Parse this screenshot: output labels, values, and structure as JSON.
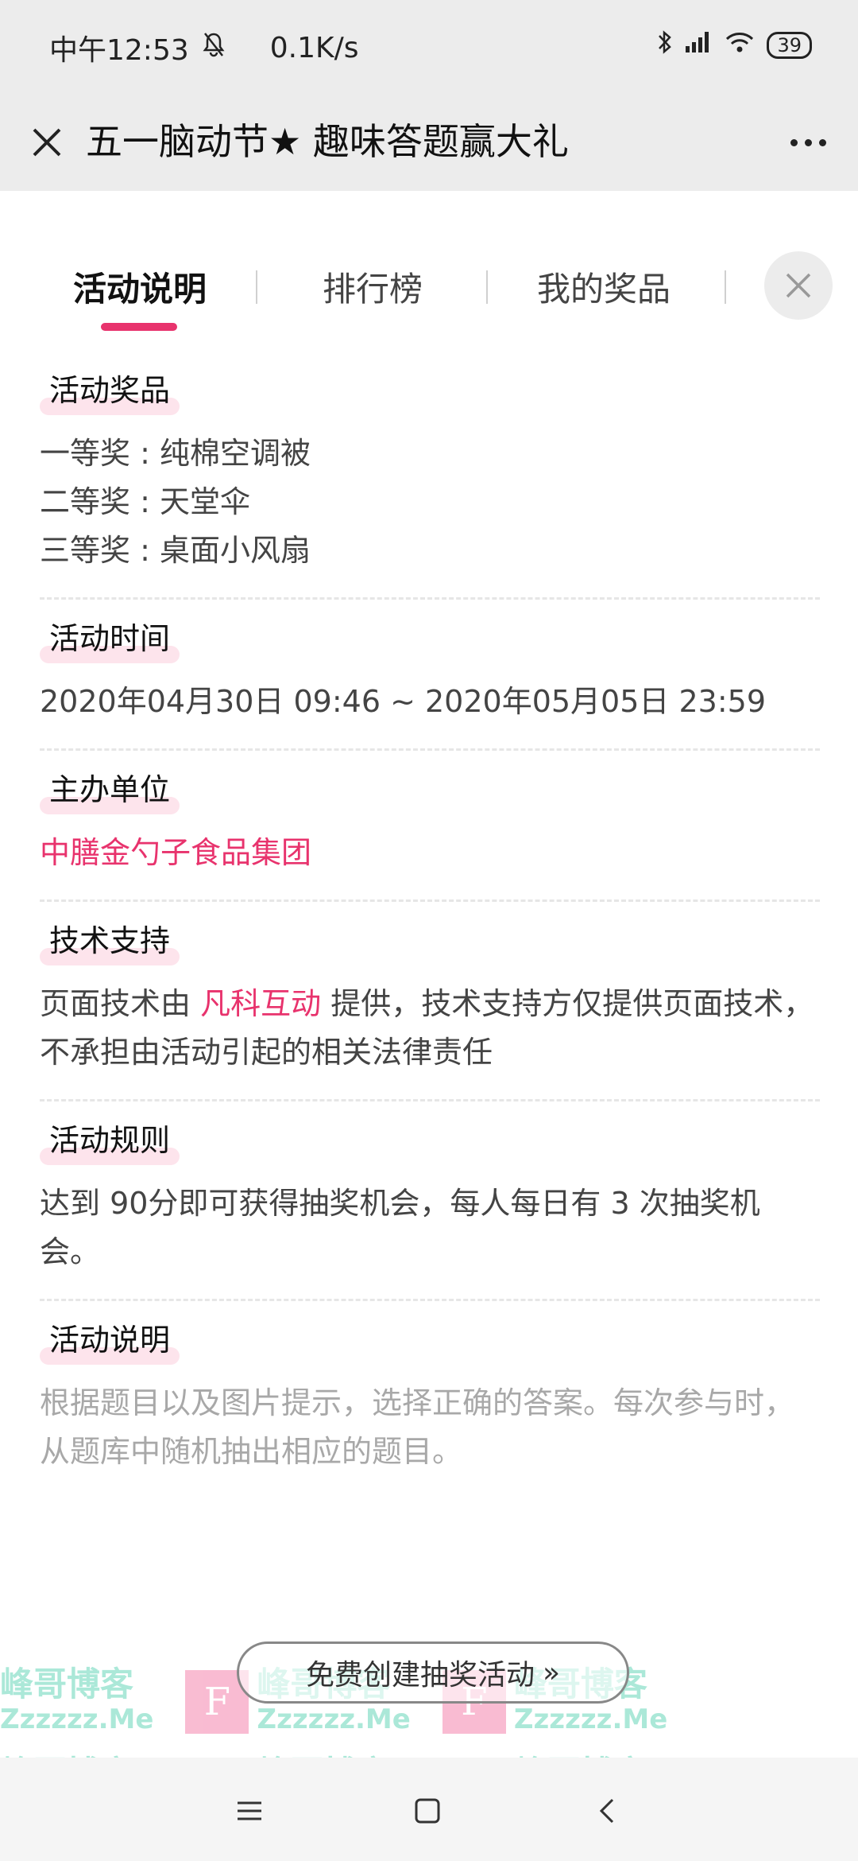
{
  "status": {
    "time": "中午12:53",
    "speed": "0.1K/s",
    "battery": "39"
  },
  "nav": {
    "title": "五一脑动节★ 趣味答题赢大礼"
  },
  "tabs": [
    {
      "label": "活动说明"
    },
    {
      "label": "排行榜"
    },
    {
      "label": "我的奖品"
    }
  ],
  "sections": {
    "prizes": {
      "title": "活动奖品",
      "lines": [
        "一等奖 : 纯棉空调被",
        "二等奖 : 天堂伞",
        "三等奖 : 桌面小风扇"
      ]
    },
    "time": {
      "title": "活动时间",
      "text": "2020年04月30日 09:46 ~ 2020年05月05日 23:59"
    },
    "organizer": {
      "title": "主办单位",
      "text": "中膳金勺子食品集团"
    },
    "tech": {
      "title": "技术支持",
      "text_before": "页面技术由 ",
      "link": "凡科互动",
      "text_after": " 提供，技术支持方仅提供页面技术，不承担由活动引起的相关法律责任"
    },
    "rules": {
      "title": "活动规则",
      "text": "达到 90分即可获得抽奖机会，每人每日有 3 次抽奖机会。"
    },
    "desc": {
      "title": "活动说明",
      "text": "根据题目以及图片提示，选择正确的答案。每次参与时，从题库中随机抽出相应的题目。"
    }
  },
  "create_button": {
    "label": "免费创建抽奖活动",
    "arrow": "»"
  },
  "watermark": {
    "logo": "F",
    "name": "峰哥博客",
    "url": "Zzzzzz.Me"
  },
  "colors": {
    "accent": "#e8336d",
    "watermark_green": "#25c49a",
    "watermark_pink": "#f04f8a"
  }
}
